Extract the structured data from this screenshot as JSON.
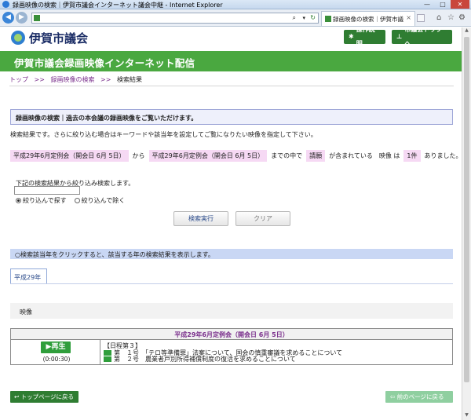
{
  "browser": {
    "window_title": "録画映像の検索｜伊賀市議会インターネット議会中継 - Internet Explorer",
    "tab_title": "録画映像の検索｜伊賀市議...",
    "minimize": "—",
    "maximize": "□",
    "close": "✕",
    "tab_close": "×"
  },
  "header": {
    "logo_text": "伊賀市議会",
    "help_button": "操作説明",
    "top_button": "市議会トップへ",
    "banner_title": "伊賀市議会録画映像インターネット配信"
  },
  "breadcrumb": {
    "top": "トップ",
    "sep": ">>",
    "search": "録画映像の検索",
    "current": "検索結果"
  },
  "search": {
    "heading": "録画映像の検索｜過去の本会議の録画映像をご覧いただけます。",
    "description": "検索結果です。さらに絞り込む場合はキーワードや該当年を設定してご覧になりたい映像を指定して下さい。",
    "condition": {
      "from": "平成29年6月定例会（開会日 6月 5日）",
      "kara": "から",
      "to": "平成29年6月定例会（開会日 6月 5日）",
      "mademo": "までの中で",
      "keyword": "請願",
      "contains": "が含まれている　映像 は",
      "count": "1件",
      "arimashita": "ありました。"
    },
    "refine_label": "下記の検索結果から絞り込み検索します。",
    "refine_value": "",
    "radio_include": "絞り込んで探す",
    "radio_exclude": "絞り込んで除く",
    "search_button": "検索実行",
    "clear_button": "クリア"
  },
  "years": {
    "note": "○検索該当年をクリックすると、該当する年の検索結果を表示します。",
    "tab": "平成29年"
  },
  "video": {
    "heading": "映像",
    "session": "平成29年6月定例会（開会日 6月 5日）",
    "play": "▶再生",
    "duration": "(0:00:30)",
    "day": "【日程第３】",
    "item1": "第　１号　「テロ等準備罪」法案について、国会の慎重審議を求めることについて",
    "item2": "第　２号　農業者戸別所得補償制度の復活を求めることについて"
  },
  "footer": {
    "back_top": "トップページに戻る",
    "back_prev": "前のページに戻る"
  }
}
